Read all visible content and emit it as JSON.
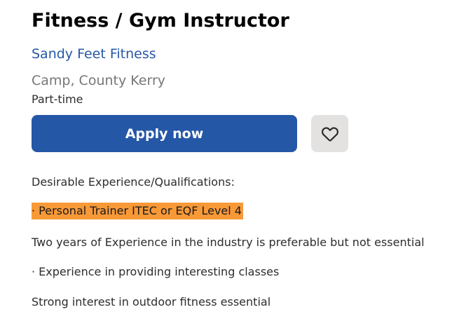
{
  "job": {
    "title": "Fitness / Gym Instructor",
    "company": "Sandy Feet Fitness",
    "location": "Camp, County Kerry",
    "type": "Part-time"
  },
  "actions": {
    "apply_label": "Apply now",
    "save_icon": "heart-outline-icon"
  },
  "description": {
    "heading": "Desirable Experience/Qualifications:",
    "highlighted_item": "· Personal Trainer ITEC or EQF Level 4",
    "line_experience": "Two years of Experience in the industry is preferable but not essential",
    "line_classes": "· Experience in providing interesting classes",
    "line_outdoor": "Strong interest in outdoor fitness essential"
  },
  "colors": {
    "brand_blue": "#2557a7",
    "highlight_orange": "#f89938",
    "save_bg": "#e4e2e0",
    "muted_text": "#767676"
  }
}
